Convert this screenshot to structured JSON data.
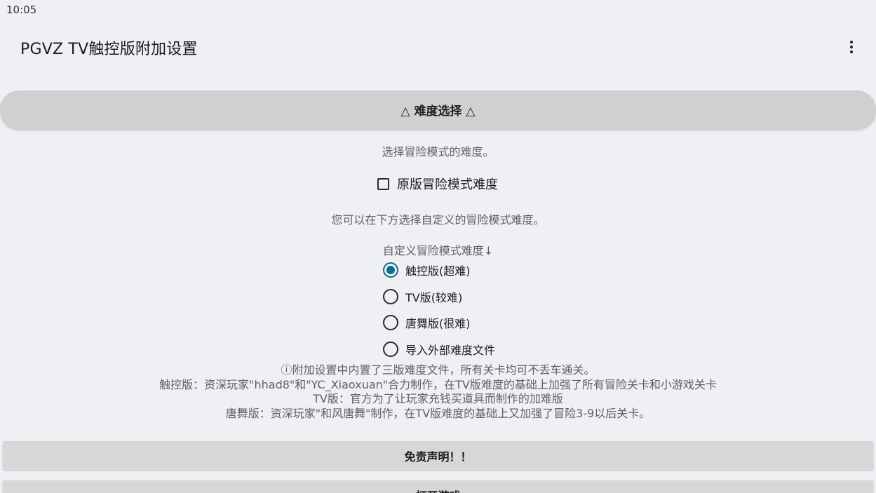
{
  "status_bar": {
    "time": "10:05"
  },
  "app_bar": {
    "title": "PGVZ TV触控版附加设置",
    "overflow_icon": "more-vert-icon"
  },
  "difficulty_section": {
    "header": "△ 难度选择 △",
    "description": "选择冒险模式的难度。",
    "original_checkbox": {
      "label": "原版冒险模式难度",
      "checked": false
    },
    "custom_hint": "您可以在下方选择自定义的冒险模式难度。",
    "custom_label": "自定义冒险模式难度↓",
    "options": [
      {
        "label": "触控版(超难)",
        "selected": true
      },
      {
        "label": "TV版(较难)",
        "selected": false
      },
      {
        "label": "唐舞版(很难)",
        "selected": false
      },
      {
        "label": "导入外部难度文件",
        "selected": false
      }
    ],
    "info_lines": [
      "ⓘ附加设置中内置了三版难度文件，所有关卡均可不丢车通关。",
      "触控版：资深玩家\"hhad8\"和\"YC_Xiaoxuan\"合力制作，在TV版难度的基础上加强了所有冒险关卡和小游戏关卡",
      "TV版：官方为了让玩家充钱买道具而制作的加难版",
      "唐舞版：资深玩家\"和风唐舞\"制作，在TV版难度的基础上又加强了冒险3-9以后关卡。"
    ]
  },
  "buttons": {
    "disclaimer": "免责声明！！",
    "open_game": "打开游戏"
  },
  "colors": {
    "background": "#eff0f3",
    "header_bg": "#d0d0d0",
    "button_bg": "#d7d7d7",
    "accent": "#0d6b8c"
  }
}
